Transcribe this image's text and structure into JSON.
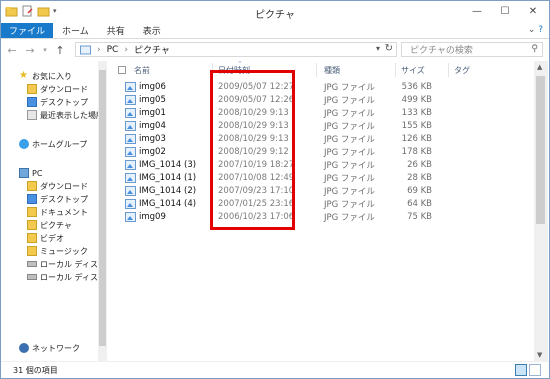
{
  "window": {
    "title": "ピクチャ"
  },
  "ribbon": {
    "tabs": [
      "ファイル",
      "ホーム",
      "共有",
      "表示"
    ],
    "help_icon": "question-icon"
  },
  "nav": {
    "path": [
      "PC",
      "ピクチャ"
    ],
    "search_placeholder": "ピクチャの検索"
  },
  "sidebar": {
    "items": [
      {
        "label": "お気に入り",
        "icon": "star-icon"
      },
      {
        "label": "ダウンロード",
        "icon": "download-folder-icon"
      },
      {
        "label": "デスクトップ",
        "icon": "desktop-folder-icon"
      },
      {
        "label": "最近表示した場所",
        "icon": "recent-places-icon"
      },
      {
        "label": "ホームグループ",
        "icon": "homegroup-icon"
      },
      {
        "label": "PC",
        "icon": "pc-icon"
      },
      {
        "label": "ダウンロード",
        "icon": "download-folder-icon"
      },
      {
        "label": "デスクトップ",
        "icon": "desktop-folder-icon"
      },
      {
        "label": "ドキュメント",
        "icon": "documents-folder-icon"
      },
      {
        "label": "ピクチャ",
        "icon": "pictures-folder-icon"
      },
      {
        "label": "ビデオ",
        "icon": "videos-folder-icon"
      },
      {
        "label": "ミュージック",
        "icon": "music-folder-icon"
      },
      {
        "label": "ローカル ディスク (C",
        "icon": "local-disk-icon"
      },
      {
        "label": "ローカル ディスク (D",
        "icon": "local-disk-icon"
      },
      {
        "label": "ネットワーク",
        "icon": "network-icon"
      }
    ]
  },
  "columns": {
    "name": "名前",
    "date": "日付時刻",
    "type": "種類",
    "size": "サイズ",
    "tag": "タグ"
  },
  "files": [
    {
      "name": "img06",
      "date": "2009/05/07 12:27",
      "type": "JPG ファイル",
      "size": "536 KB"
    },
    {
      "name": "img05",
      "date": "2009/05/07 12:26",
      "type": "JPG ファイル",
      "size": "499 KB"
    },
    {
      "name": "img01",
      "date": "2008/10/29 9:13",
      "type": "JPG ファイル",
      "size": "133 KB"
    },
    {
      "name": "img04",
      "date": "2008/10/29 9:13",
      "type": "JPG ファイル",
      "size": "155 KB"
    },
    {
      "name": "img03",
      "date": "2008/10/29 9:13",
      "type": "JPG ファイル",
      "size": "126 KB"
    },
    {
      "name": "img02",
      "date": "2008/10/29 9:12",
      "type": "JPG ファイル",
      "size": "178 KB"
    },
    {
      "name": "IMG_1014 (3)",
      "date": "2007/10/19 18:27",
      "type": "JPG ファイル",
      "size": "26 KB"
    },
    {
      "name": "IMG_1014 (1)",
      "date": "2007/10/08 12:49",
      "type": "JPG ファイル",
      "size": "28 KB"
    },
    {
      "name": "IMG_1014 (2)",
      "date": "2007/09/23 17:10",
      "type": "JPG ファイル",
      "size": "69 KB"
    },
    {
      "name": "IMG_1014 (4)",
      "date": "2007/01/25 23:16",
      "type": "JPG ファイル",
      "size": "64 KB"
    },
    {
      "name": "img09",
      "date": "2006/10/23 17:06",
      "type": "JPG ファイル",
      "size": "75 KB"
    }
  ],
  "status": {
    "count": "31 個の項目"
  },
  "colors": {
    "accent": "#1979ca",
    "highlight_border": "#e30000"
  }
}
